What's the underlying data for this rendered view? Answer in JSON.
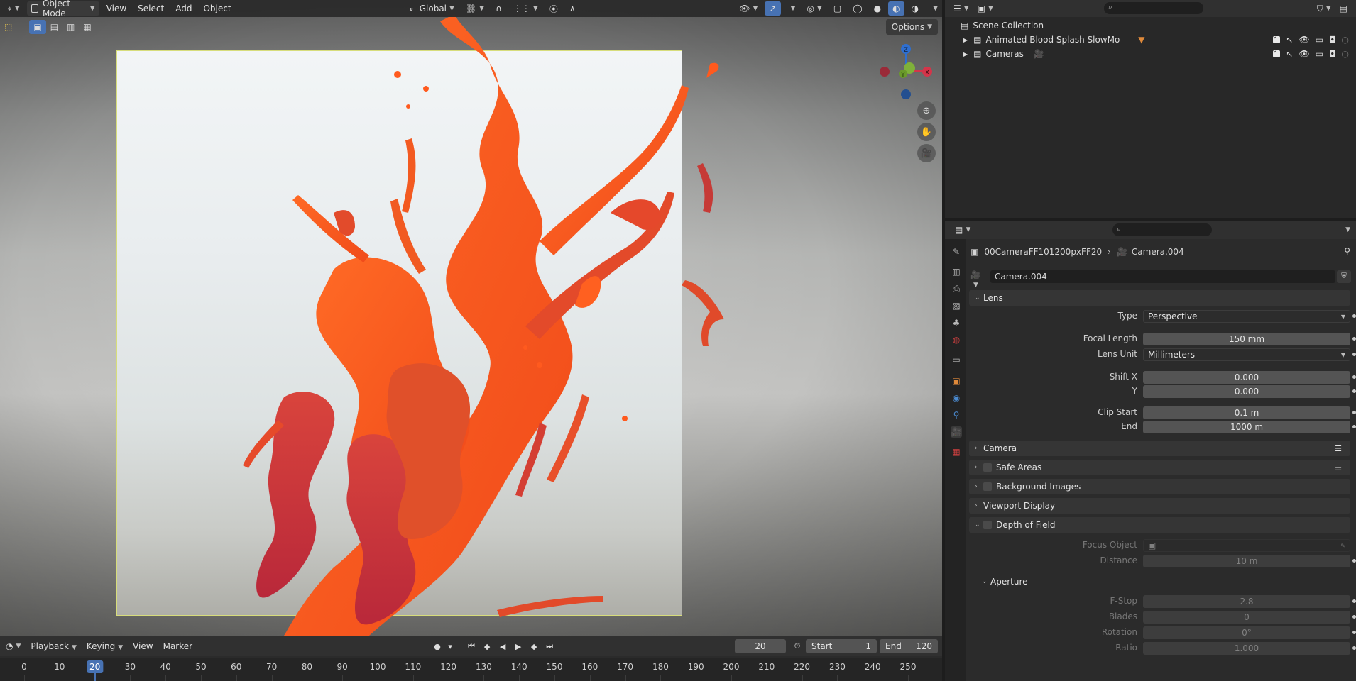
{
  "viewport": {
    "mode": "Object Mode",
    "menus": [
      "View",
      "Select",
      "Add",
      "Object"
    ],
    "transform_orientation": "Global",
    "options_label": "Options",
    "gizmo_axes": [
      "Z",
      "Y",
      "X"
    ]
  },
  "timeline": {
    "menus": [
      "Playback",
      "Keying",
      "View",
      "Marker"
    ],
    "current_frame": "20",
    "start_label": "Start",
    "start_value": "1",
    "end_label": "End",
    "end_value": "120",
    "ticks": [
      "0",
      "10",
      "20",
      "30",
      "40",
      "50",
      "60",
      "70",
      "80",
      "90",
      "100",
      "110",
      "120",
      "130",
      "140",
      "150",
      "160",
      "170",
      "180",
      "190",
      "200",
      "210",
      "220",
      "230",
      "240",
      "250"
    ]
  },
  "outliner": {
    "root": "Scene Collection",
    "items": [
      {
        "label": "Animated Blood Splash SlowMo"
      },
      {
        "label": "Cameras"
      }
    ]
  },
  "properties": {
    "breadcrumb_object": "00CameraFF101200pxFF20",
    "breadcrumb_data": "Camera.004",
    "datablock_name": "Camera.004",
    "lens": {
      "title": "Lens",
      "type_label": "Type",
      "type_value": "Perspective",
      "focal_label": "Focal Length",
      "focal_value": "150 mm",
      "unit_label": "Lens Unit",
      "unit_value": "Millimeters",
      "shiftx_label": "Shift X",
      "shiftx_value": "0.000",
      "shifty_label": "Y",
      "shifty_value": "0.000",
      "clipstart_label": "Clip Start",
      "clipstart_value": "0.1 m",
      "clipend_label": "End",
      "clipend_value": "1000 m"
    },
    "panels": {
      "camera": "Camera",
      "safe_areas": "Safe Areas",
      "background_images": "Background Images",
      "viewport_display": "Viewport Display",
      "dof": "Depth of Field"
    },
    "dof": {
      "focus_label": "Focus Object",
      "distance_label": "Distance",
      "distance_value": "10 m",
      "aperture_title": "Aperture",
      "fstop_label": "F-Stop",
      "fstop_value": "2.8",
      "blades_label": "Blades",
      "blades_value": "0",
      "rotation_label": "Rotation",
      "rotation_value": "0°",
      "ratio_label": "Ratio",
      "ratio_value": "1.000"
    }
  },
  "colors": {
    "accent": "#4772b3",
    "splash_orange": "#ff5a1e",
    "splash_red": "#c2303a",
    "camera_frame": "#d7dd7b"
  }
}
